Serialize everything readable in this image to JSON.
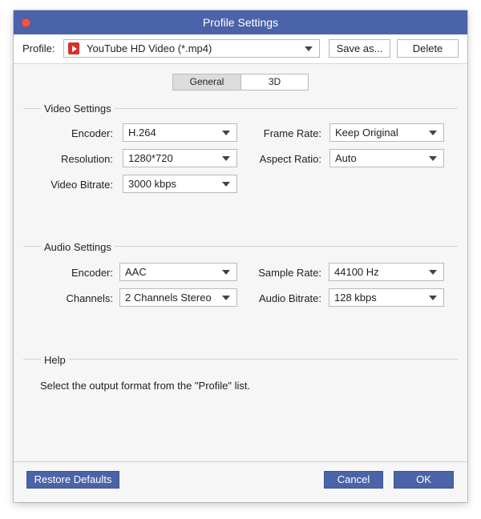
{
  "window": {
    "title": "Profile Settings"
  },
  "profile": {
    "label": "Profile:",
    "value": "YouTube HD Video (*.mp4)",
    "icon": "youtube-icon",
    "save_as": "Save as...",
    "delete": "Delete"
  },
  "tabs": [
    {
      "label": "General",
      "active": true
    },
    {
      "label": "3D",
      "active": false
    }
  ],
  "video": {
    "title": "Video Settings",
    "encoder": {
      "label": "Encoder:",
      "value": "H.264"
    },
    "frame_rate": {
      "label": "Frame Rate:",
      "value": "Keep Original"
    },
    "resolution": {
      "label": "Resolution:",
      "value": "1280*720"
    },
    "aspect_ratio": {
      "label": "Aspect Ratio:",
      "value": "Auto"
    },
    "bitrate": {
      "label": "Video Bitrate:",
      "value": "3000 kbps"
    }
  },
  "audio": {
    "title": "Audio Settings",
    "encoder": {
      "label": "Encoder:",
      "value": "AAC"
    },
    "sample_rate": {
      "label": "Sample Rate:",
      "value": "44100 Hz"
    },
    "channels": {
      "label": "Channels:",
      "value": "2 Channels Stereo"
    },
    "bitrate": {
      "label": "Audio Bitrate:",
      "value": "128 kbps"
    }
  },
  "help": {
    "title": "Help",
    "text": "Select the output format from the \"Profile\" list."
  },
  "footer": {
    "restore": "Restore Defaults",
    "cancel": "Cancel",
    "ok": "OK"
  },
  "colors": {
    "accent": "#4b63a8",
    "close": "#f0584a"
  }
}
